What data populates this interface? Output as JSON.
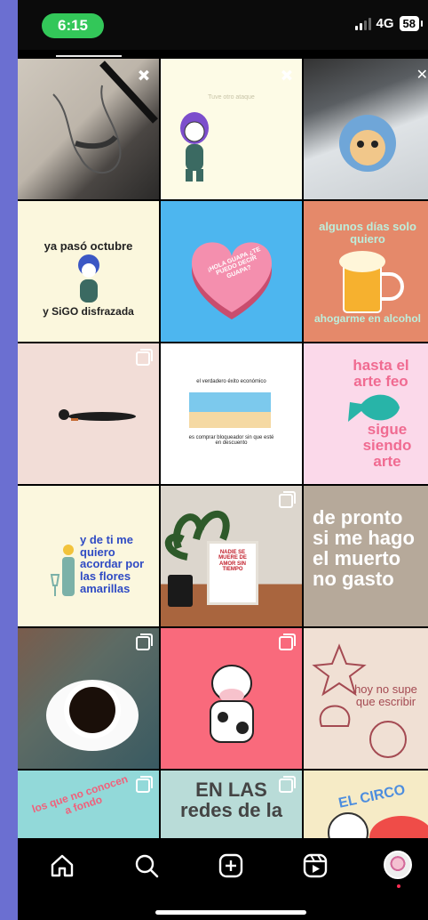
{
  "status_bar": {
    "time": "6:15",
    "network": "4G",
    "battery": "58"
  },
  "tiles": [
    {
      "name": "sketch-drawing",
      "bg": "#3a3734",
      "badge": "pin"
    },
    {
      "name": "girl-sitting-drawing",
      "bg": "#fdfbe6",
      "text": "Tuve otro ataque",
      "badge": "pin"
    },
    {
      "name": "cat-drawing-keyboard",
      "bg": "#7b7f84",
      "badge": "close"
    },
    {
      "name": "disfrazada-post",
      "bg": "#fbf7dd",
      "text_top": "ya pasó octubre",
      "text_bottom": "y SiGO disfrazada"
    },
    {
      "name": "heart-candy-post",
      "bg": "#4db6ef",
      "text": "¡HOLA GUAPA ¿TE PUEDO DECIR GUAPA?"
    },
    {
      "name": "beer-post",
      "bg": "#e5896a",
      "text_top": "algunos días solo quiero",
      "text_bottom": "ahogarme en alcohol"
    },
    {
      "name": "lying-figure-post",
      "bg": "#f2ddd7",
      "badge": "carousel"
    },
    {
      "name": "beach-post",
      "bg": "#ffffff",
      "text_top": "el verdadero éxito económico",
      "text_bottom": "es comprar bloqueador sin que esté en descuento"
    },
    {
      "name": "fish-post",
      "bg": "#fbd9ea",
      "text_top": "hasta el arte feo",
      "text_bottom": "sigue siendo arte"
    },
    {
      "name": "flores-amarillas-post",
      "bg": "#fbf7de",
      "text": "y de ti me quiero acordar por las flores amarillas"
    },
    {
      "name": "plant-frame-photo",
      "bg": "#d9d2c8",
      "text": "NADIE SE MUERE DE AMOR SIN TIEMPO",
      "badge": "carousel"
    },
    {
      "name": "muerto-post",
      "bg": "#b6a99a",
      "text": "de pronto si me hago el muerto no gasto"
    },
    {
      "name": "coffee-photo",
      "bg": "#4d5a55",
      "badge": "carousel"
    },
    {
      "name": "cow-post",
      "bg": "#f96a7c",
      "badge": "carousel"
    },
    {
      "name": "shells-post",
      "bg": "#f0e0d4",
      "text": "hoy no supe que escribir"
    },
    {
      "name": "los-que-post",
      "bg": "#92d9d9",
      "text": "los que no conocen a fondo",
      "badge": "carousel"
    },
    {
      "name": "redes-post",
      "bg": "#b9dcd8",
      "text": "EN LAS redes de la",
      "badge": "carousel"
    },
    {
      "name": "circo-post",
      "bg": "#f6ebc6",
      "text": "EL CIRCO"
    }
  ],
  "colors": {
    "accent_green": "#33c759",
    "background": "#6b6fd1",
    "notification_dot": "#ff2e55"
  },
  "nav": [
    {
      "name": "home-icon"
    },
    {
      "name": "search-icon"
    },
    {
      "name": "create-icon"
    },
    {
      "name": "reels-icon"
    },
    {
      "name": "profile-avatar"
    }
  ]
}
